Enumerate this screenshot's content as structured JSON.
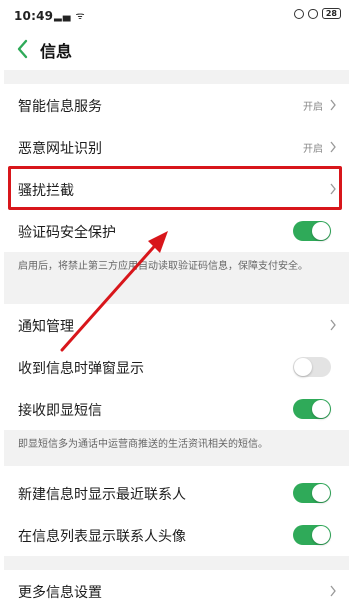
{
  "status_bar": {
    "time": "10:49",
    "signal": "▂▄ ᯤ",
    "battery": "28"
  },
  "header": {
    "title": "信息"
  },
  "rows": {
    "smart_service": {
      "label": "智能信息服务",
      "value": "开启"
    },
    "malicious_url": {
      "label": "恶意网址识别",
      "value": "开启"
    },
    "harassment": {
      "label": "骚扰拦截"
    },
    "code_protect": {
      "label": "验证码安全保护",
      "toggle": "on"
    },
    "notification": {
      "label": "通知管理"
    },
    "popup": {
      "label": "收到信息时弹窗显示",
      "toggle": "off"
    },
    "flash_sms": {
      "label": "接收即显短信",
      "toggle": "on"
    },
    "recent_contacts": {
      "label": "新建信息时显示最近联系人",
      "toggle": "on"
    },
    "avatar": {
      "label": "在信息列表显示联系人头像",
      "toggle": "on"
    },
    "more": {
      "label": "更多信息设置"
    }
  },
  "notes": {
    "code_protect": "启用后，将禁止第三方应用自动读取验证码信息，保障支付安全。",
    "flash_sms": "即显短信多为通话中运营商推送的生活资讯相关的短信。"
  },
  "colors": {
    "toggle_on": "#2faa59",
    "highlight": "#d8161b",
    "section_bg": "#f2f2f2"
  }
}
